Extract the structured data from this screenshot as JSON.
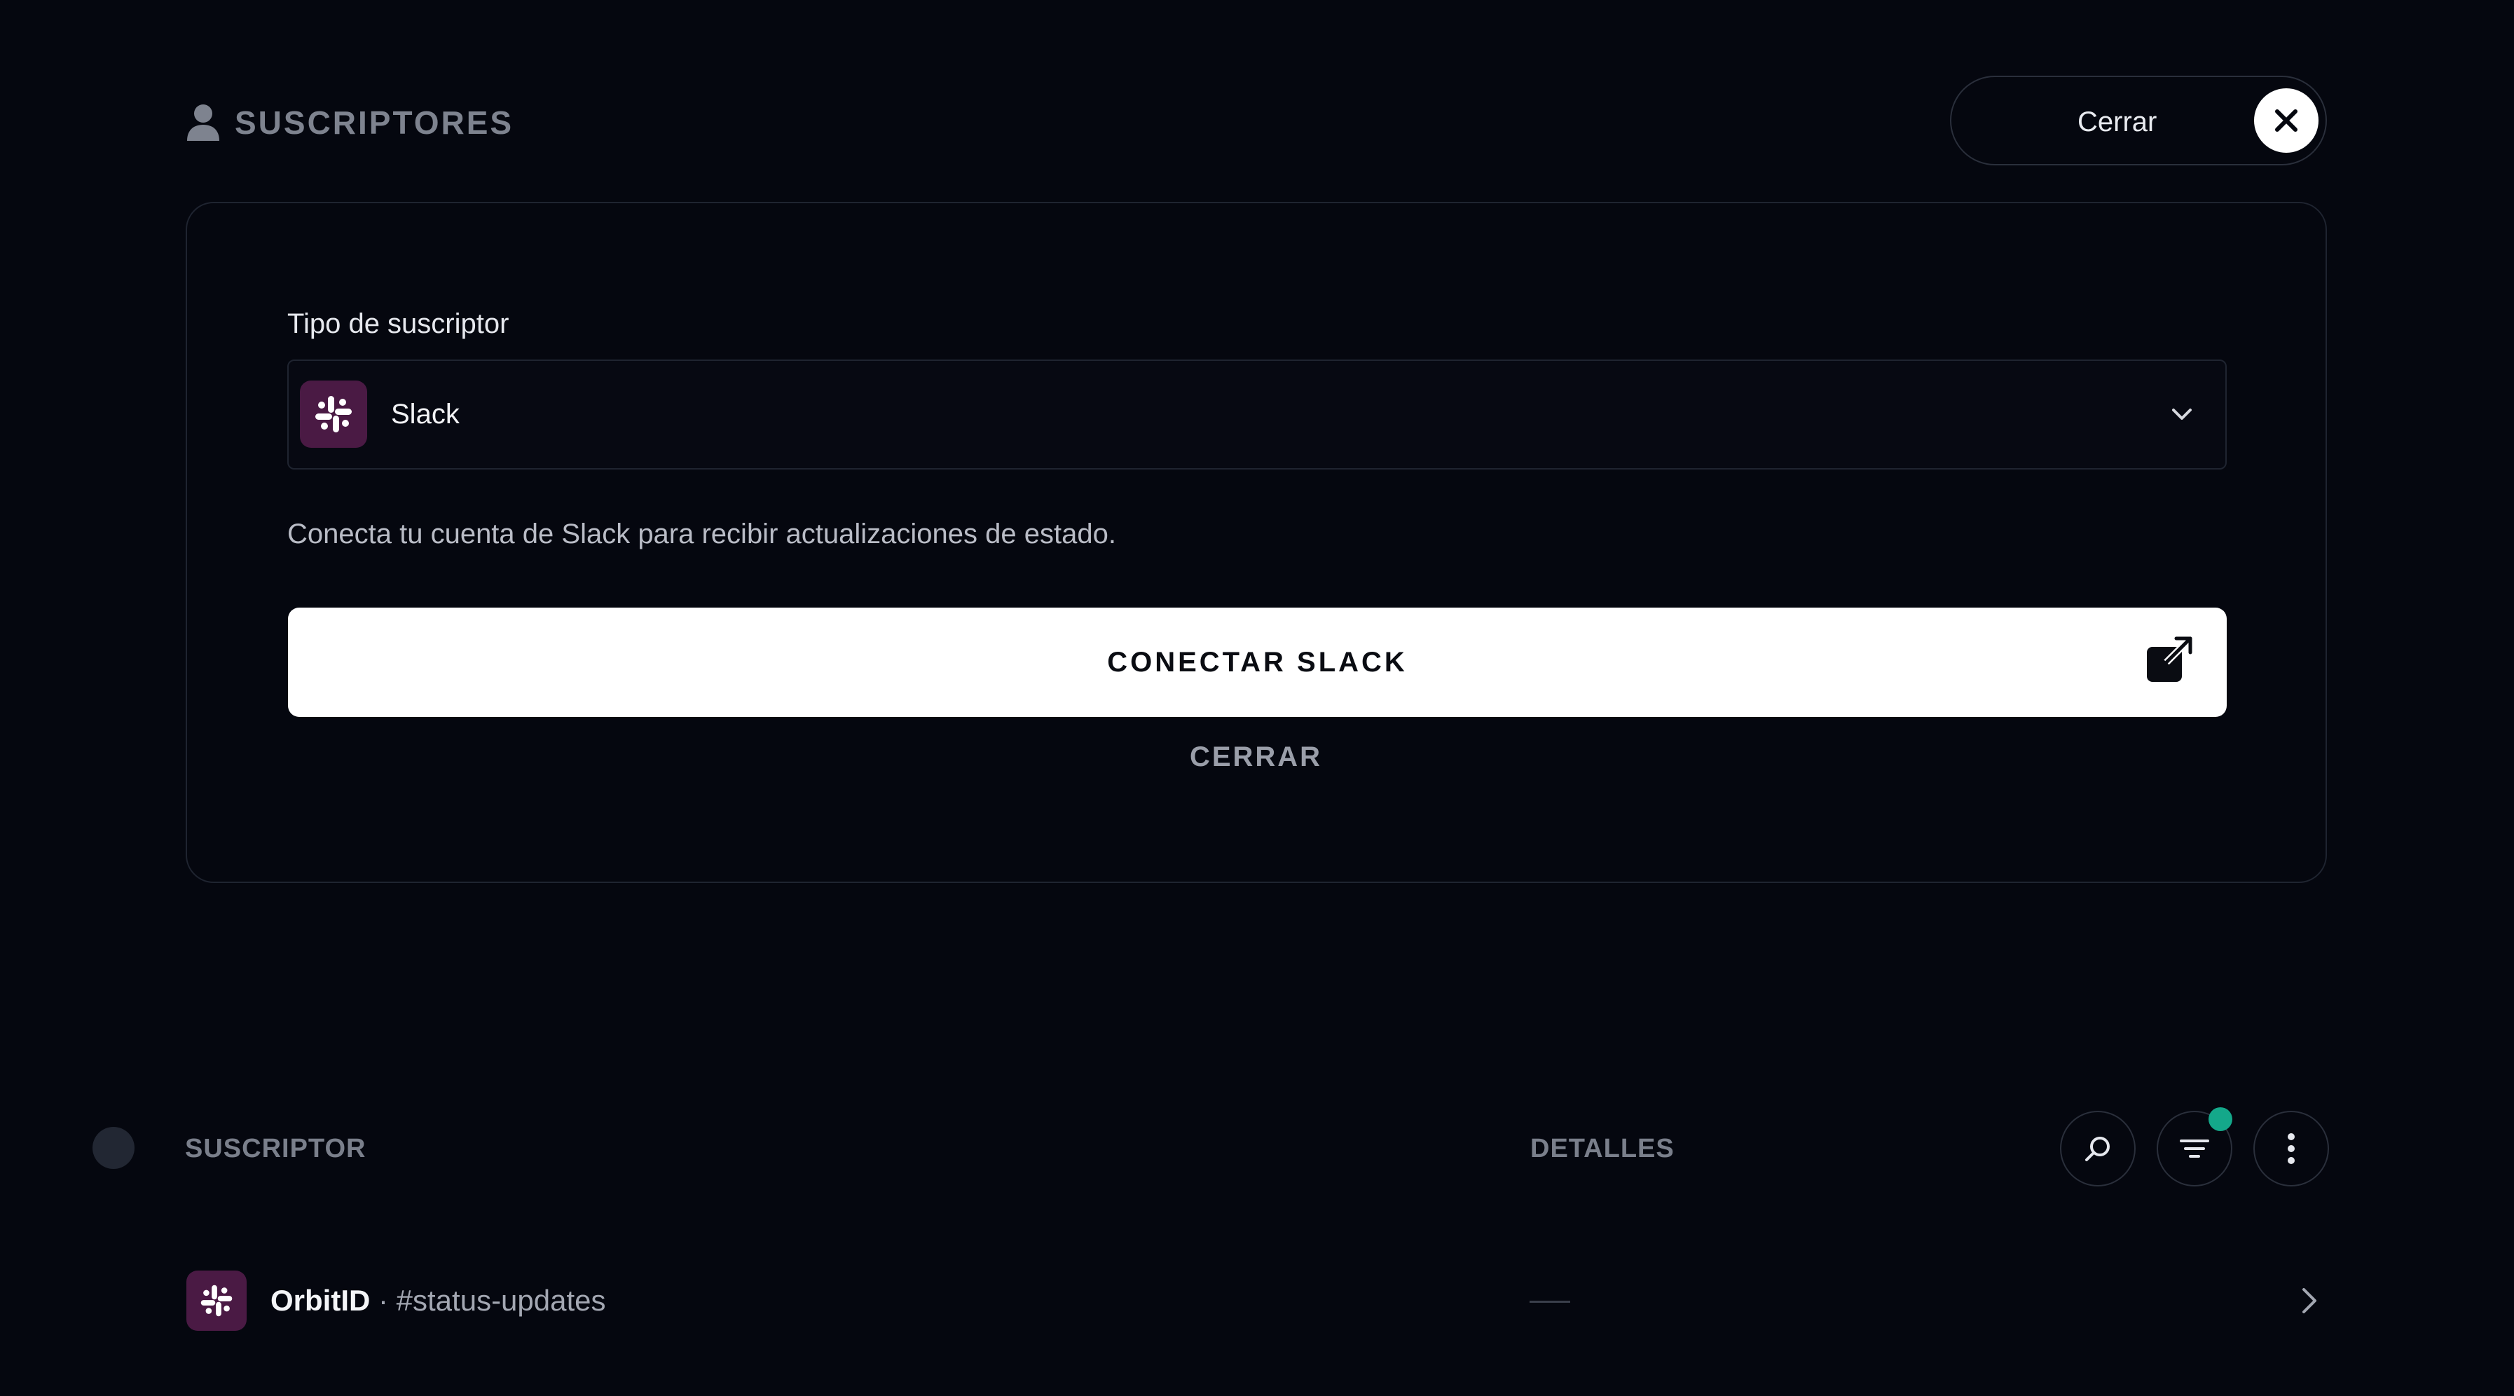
{
  "header": {
    "title": "SUSCRIPTORES",
    "close_label": "Cerrar"
  },
  "form": {
    "field_label": "Tipo de suscriptor",
    "selected_type": "Slack",
    "helper_text": "Conecta tu cuenta de Slack para recibir actualizaciones de estado.",
    "connect_label": "CONECTAR SLACK",
    "cancel_label": "CERRAR"
  },
  "table": {
    "columns": [
      "SUSCRIPTOR",
      "DETALLES"
    ],
    "rows": [
      {
        "name": "OrbitID",
        "separator": " · ",
        "channel": "#status-updates",
        "details": "—"
      }
    ]
  },
  "colors": {
    "background": "#05070f",
    "slack_badge": "#4a1a44",
    "filter_indicator": "#14a88a"
  },
  "icons": [
    "user-icon",
    "close-icon",
    "slack-icon",
    "chevron-down-icon",
    "external-link-icon",
    "search-icon",
    "filter-icon",
    "more-vertical-icon",
    "chevron-right-icon"
  ]
}
